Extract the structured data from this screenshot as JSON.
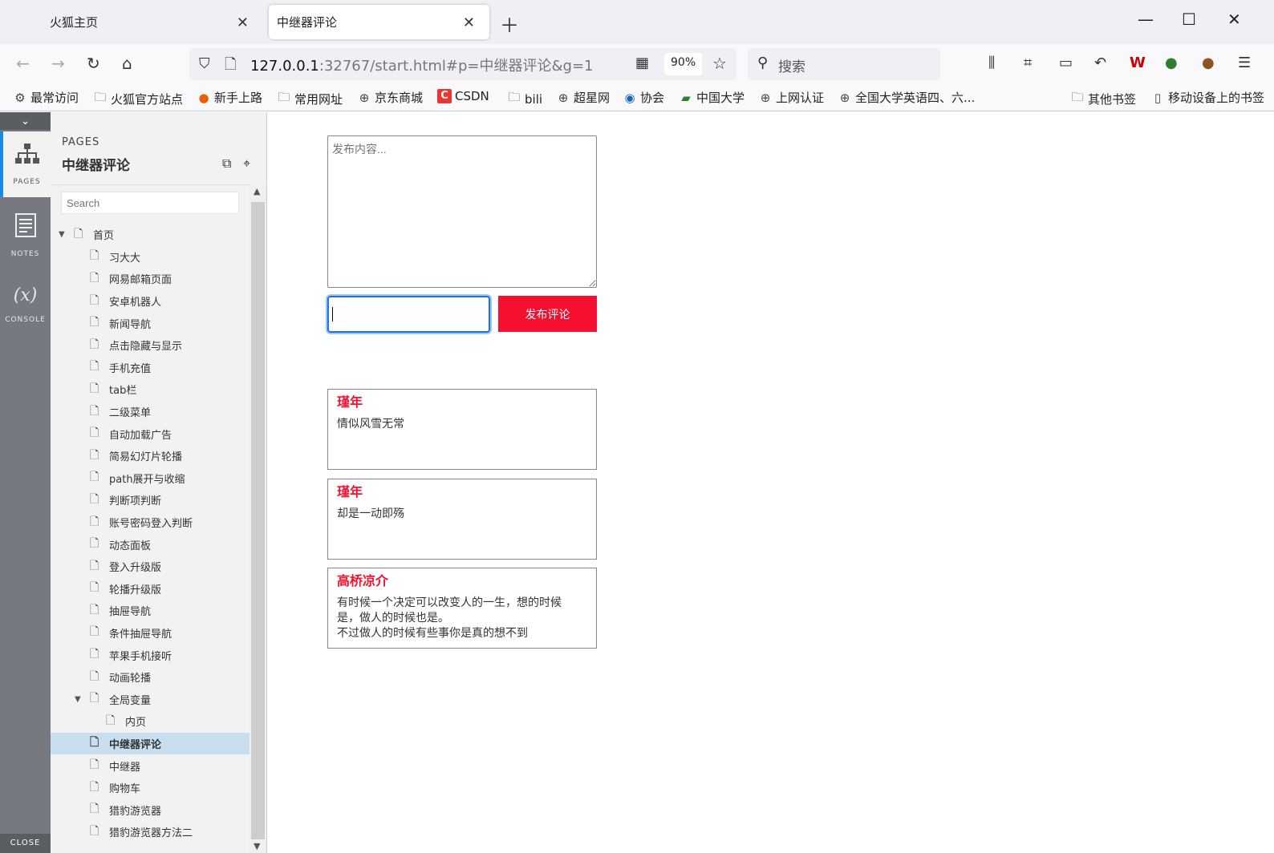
{
  "tabs": [
    {
      "label": "火狐主页"
    },
    {
      "label": "中继器评论"
    }
  ],
  "nav": {
    "url_host": "127.0.0.1",
    "url_rest": ":32767/start.html#p=中继器评论&g=1",
    "zoom": "90%",
    "search_placeholder": "搜索"
  },
  "bookmarks": [
    {
      "label": "最常访问",
      "icon": "gear-icon"
    },
    {
      "label": "火狐官方站点",
      "icon": "folder-icon"
    },
    {
      "label": "新手上路",
      "icon": "firefox-icon"
    },
    {
      "label": "常用网址",
      "icon": "folder-icon"
    },
    {
      "label": "京东商城",
      "icon": "globe-icon"
    },
    {
      "label": "CSDN",
      "icon": "csdn-icon"
    },
    {
      "label": "bili",
      "icon": "folder-icon"
    },
    {
      "label": "超星网",
      "icon": "globe-icon"
    },
    {
      "label": "协会",
      "icon": "globe-icon"
    },
    {
      "label": "中国大学",
      "icon": "book-icon"
    },
    {
      "label": "上网认证",
      "icon": "globe-icon"
    },
    {
      "label": "全国大学英语四、六...",
      "icon": "globe-icon"
    },
    {
      "label": "其他书签",
      "icon": "folder-icon"
    },
    {
      "label": "移动设备上的书签",
      "icon": "mobile-icon"
    }
  ],
  "rail": {
    "pages_label": "PAGES",
    "notes_label": "NOTES",
    "console_label": "CONSOLE",
    "console_glyph": "(x)",
    "close_label": "CLOSE"
  },
  "pages_panel": {
    "header": "PAGES",
    "title": "中继器评论",
    "search_placeholder": "Search",
    "tree": [
      {
        "label": "首页",
        "level": 0,
        "expanded": true
      },
      {
        "label": "习大大",
        "level": 1
      },
      {
        "label": "网易邮箱页面",
        "level": 1
      },
      {
        "label": "安卓机器人",
        "level": 1
      },
      {
        "label": "新闻导航",
        "level": 1
      },
      {
        "label": "点击隐藏与显示",
        "level": 1
      },
      {
        "label": "手机充值",
        "level": 1
      },
      {
        "label": "tab栏",
        "level": 1
      },
      {
        "label": "二级菜单",
        "level": 1
      },
      {
        "label": "自动加载广告",
        "level": 1
      },
      {
        "label": "简易幻灯片轮播",
        "level": 1
      },
      {
        "label": "path展开与收缩",
        "level": 1
      },
      {
        "label": "判断项判断",
        "level": 1
      },
      {
        "label": "账号密码登入判断",
        "level": 1
      },
      {
        "label": "动态面板",
        "level": 1
      },
      {
        "label": "登入升级版",
        "level": 1
      },
      {
        "label": "轮播升级版",
        "level": 1
      },
      {
        "label": "抽屉导航",
        "level": 1
      },
      {
        "label": "条件抽屉导航",
        "level": 1
      },
      {
        "label": "苹果手机接听",
        "level": 1
      },
      {
        "label": "动画轮播",
        "level": 1
      },
      {
        "label": "全局变量",
        "level": 1,
        "expanded": true
      },
      {
        "label": "内页",
        "level": 2
      },
      {
        "label": "中继器评论",
        "level": 1,
        "selected": true
      },
      {
        "label": "中继器",
        "level": 1
      },
      {
        "label": "购物车",
        "level": 1
      },
      {
        "label": "猎豹游览器",
        "level": 1
      },
      {
        "label": "猎豹游览器方法二",
        "level": 1
      }
    ]
  },
  "main": {
    "post_placeholder": "发布内容...",
    "name_value": "",
    "submit_label": "发布评论",
    "comments": [
      {
        "author": "瑾年",
        "text": "情似风雪无常"
      },
      {
        "author": "瑾年",
        "text": "却是一动即殇"
      },
      {
        "author": "高桥凉介",
        "text": "有时候一个决定可以改变人的一生，想的时候\n是，做人的时候也是。\n不过做人的时候有些事你是真的想不到"
      }
    ]
  },
  "colors": {
    "accent_red": "#f5102f",
    "focus_blue": "#1a73e8",
    "rail_gray": "#76797f",
    "selected_row": "#c8dff0"
  }
}
